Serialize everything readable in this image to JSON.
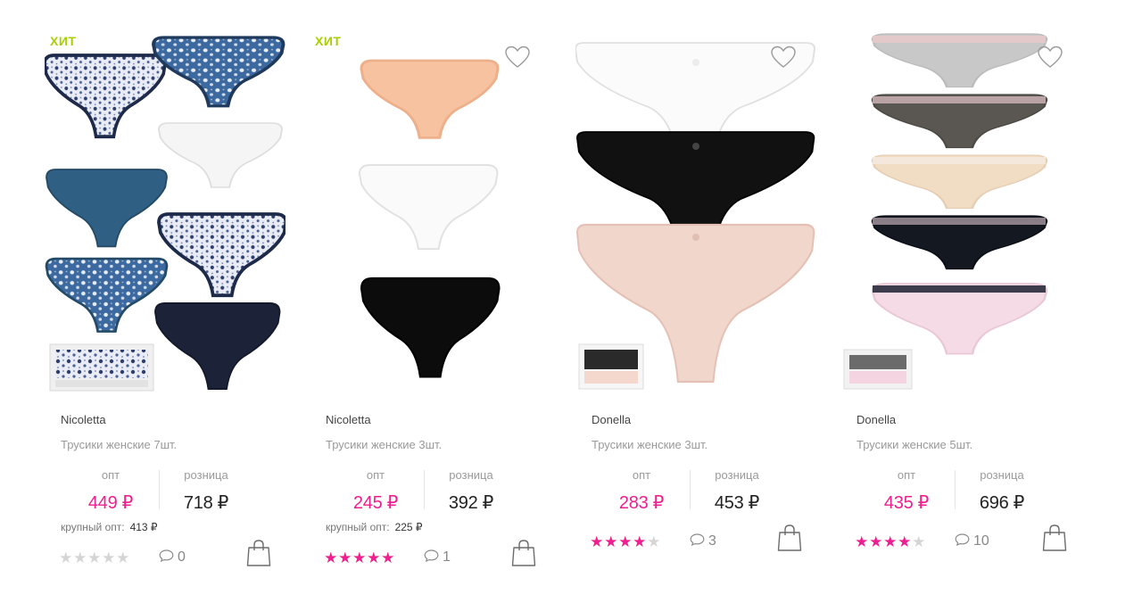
{
  "colors": {
    "accent": "#ee1f8f",
    "hit_badge": "#a8d000",
    "muted_text": "#9a9a9a",
    "star_off": "#d5d5d5"
  },
  "labels": {
    "opt": "опт",
    "retail": "розница",
    "bulk": "крупный опт:"
  },
  "products": [
    {
      "badge": "ХИТ",
      "brand": "Nicoletta",
      "name": "Трусики женские 7шт.",
      "price_opt": "449 ₽",
      "price_retail": "718 ₽",
      "bulk_price": "413 ₽",
      "rating": 0,
      "comments": "0",
      "favorite_icon": "heart-outline-icon",
      "cart_icon": "shopping-bag-icon"
    },
    {
      "badge": "ХИТ",
      "brand": "Nicoletta",
      "name": "Трусики женские 3шт.",
      "price_opt": "245 ₽",
      "price_retail": "392 ₽",
      "bulk_price": "225 ₽",
      "rating": 5,
      "comments": "1",
      "favorite_icon": "heart-outline-icon",
      "cart_icon": "shopping-bag-icon"
    },
    {
      "badge": "",
      "brand": "Donella",
      "name": "Трусики женские 3шт.",
      "price_opt": "283 ₽",
      "price_retail": "453 ₽",
      "bulk_price": "",
      "rating": 4,
      "comments": "3",
      "favorite_icon": "heart-outline-icon",
      "cart_icon": "shopping-bag-icon"
    },
    {
      "badge": "",
      "brand": "Donella",
      "name": "Трусики женские 5шт.",
      "price_opt": "435 ₽",
      "price_retail": "696 ₽",
      "bulk_price": "",
      "rating": 4,
      "comments": "10",
      "favorite_icon": "heart-outline-icon",
      "cart_icon": "shopping-bag-icon"
    }
  ]
}
